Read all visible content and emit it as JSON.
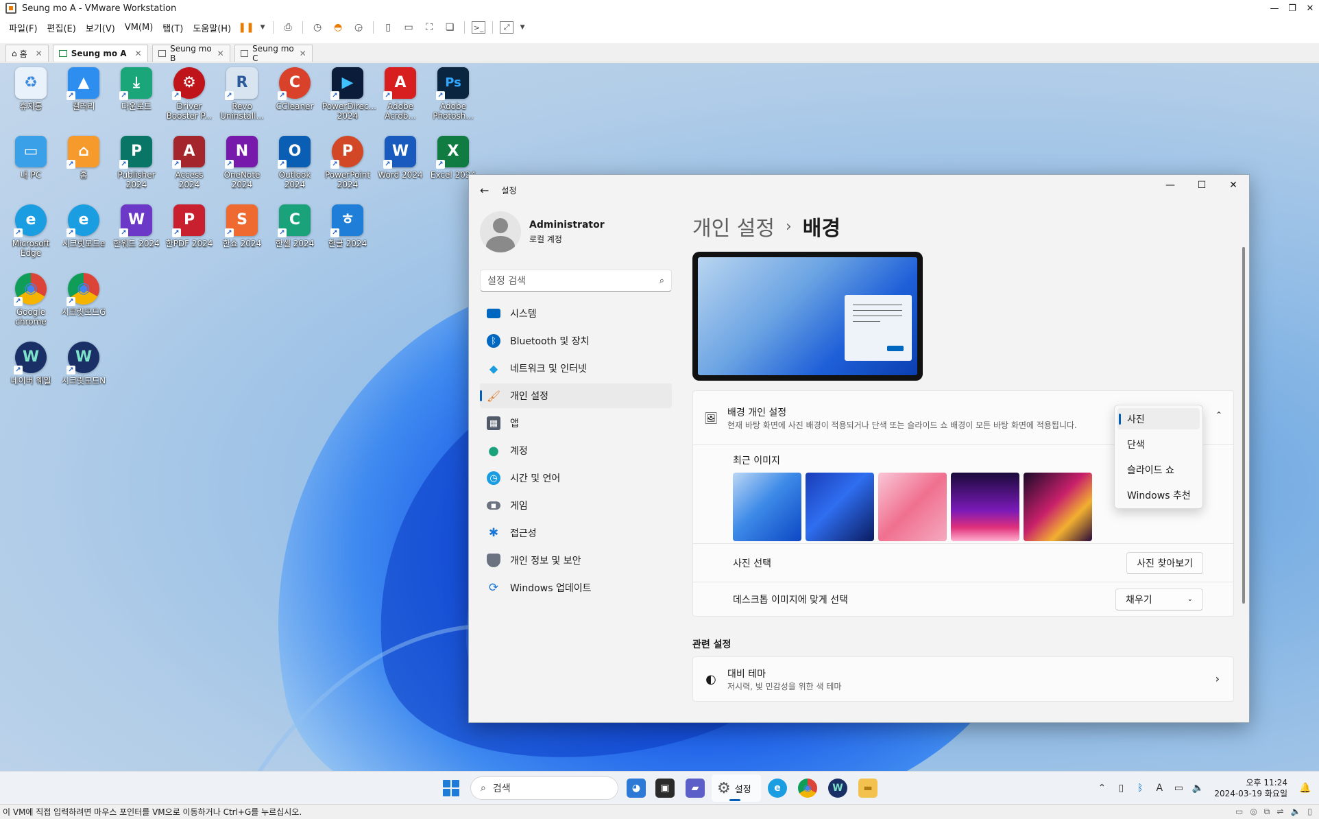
{
  "vmware": {
    "title": "Seung mo A - VMware Workstation",
    "menu": [
      "파일(F)",
      "편집(E)",
      "보기(V)",
      "VM(M)",
      "탭(T)",
      "도움말(H)"
    ],
    "tabs": [
      {
        "label": "홈"
      },
      {
        "label": "Seung mo A"
      },
      {
        "label": "Seung mo B"
      },
      {
        "label": "Seung mo C"
      }
    ],
    "status_text": "이 VM에 직접 입력하려면 마우스 포인터를 VM으로 이동하거나 Ctrl+G를 누르십시오."
  },
  "desktop": {
    "icons": [
      {
        "label": "휴지통",
        "color": "#ffffff",
        "glyph": "♻"
      },
      {
        "label": "갤러리",
        "color": "#2e8ef0",
        "glyph": "▲"
      },
      {
        "label": "다운로드",
        "color": "#1ba67a",
        "glyph": "⤓"
      },
      {
        "label": "Driver Booster P...",
        "color": "#c0141b",
        "glyph": "⚙"
      },
      {
        "label": "Revo Uninstall...",
        "color": "#d8e4f0",
        "glyph": "R"
      },
      {
        "label": "CCleaner",
        "color": "#d9412a",
        "glyph": "C"
      },
      {
        "label": "PowerDirec... 2024",
        "color": "#0b1b3a",
        "glyph": "▶"
      },
      {
        "label": "Adobe Acrob...",
        "color": "#d81f1f",
        "glyph": "A"
      },
      {
        "label": "Adobe Photosh...",
        "color": "#0a2540",
        "glyph": "Ps"
      },
      {
        "label": "내 PC",
        "color": "#3aa0e8",
        "glyph": "▭"
      },
      {
        "label": "홈",
        "color": "#f59a2b",
        "glyph": "⌂"
      },
      {
        "label": "Publisher 2024",
        "color": "#087566",
        "glyph": "P"
      },
      {
        "label": "Access 2024",
        "color": "#a4262c",
        "glyph": "A"
      },
      {
        "label": "OneNote 2024",
        "color": "#7719aa",
        "glyph": "N"
      },
      {
        "label": "Outlook 2024",
        "color": "#0a5fb4",
        "glyph": "O"
      },
      {
        "label": "PowerPoint 2024",
        "color": "#d24726",
        "glyph": "P"
      },
      {
        "label": "Word 2024",
        "color": "#185abd",
        "glyph": "W"
      },
      {
        "label": "Excel 2024",
        "color": "#107c41",
        "glyph": "X"
      },
      {
        "label": "Microsoft Edge",
        "color": "#1b9de2",
        "glyph": "e"
      },
      {
        "label": "시크릿모드e",
        "color": "#1b9de2",
        "glyph": "e"
      },
      {
        "label": "한워드 2024",
        "color": "#6b38c8",
        "glyph": "W"
      },
      {
        "label": "한PDF 2024",
        "color": "#c8202f",
        "glyph": "P"
      },
      {
        "label": "한쇼 2024",
        "color": "#ef6a30",
        "glyph": "S"
      },
      {
        "label": "한셀 2024",
        "color": "#1aa37a",
        "glyph": "C"
      },
      {
        "label": "한글 2024",
        "color": "#1f7fd8",
        "glyph": "ㅎ"
      },
      {
        "label": "Google chrome",
        "color": "#ffffff",
        "glyph": "◉"
      },
      {
        "label": "시크릿모드G",
        "color": "#ffffff",
        "glyph": "◉"
      },
      {
        "label": "네이버 웨일",
        "color": "#1a2f66",
        "glyph": "W"
      },
      {
        "label": "시크릿모드N",
        "color": "#1a2f66",
        "glyph": "W"
      }
    ]
  },
  "settings": {
    "app_title": "설정",
    "profile": {
      "name": "Administrator",
      "sub": "로컬 계정"
    },
    "search_placeholder": "설정 검색",
    "nav": [
      {
        "label": "시스템",
        "icon": "monitor-icon",
        "color": "#0067c0"
      },
      {
        "label": "Bluetooth 및 장치",
        "icon": "bluetooth-icon",
        "color": "#0067c0"
      },
      {
        "label": "네트워크 및 인터넷",
        "icon": "wifi-icon",
        "color": "#1b9de2"
      },
      {
        "label": "개인 설정",
        "icon": "brush-icon",
        "color": "#e07b2a"
      },
      {
        "label": "앱",
        "icon": "apps-icon",
        "color": "#505a68"
      },
      {
        "label": "계정",
        "icon": "person-icon",
        "color": "#1aa37a"
      },
      {
        "label": "시간 및 언어",
        "icon": "clock-icon",
        "color": "#1b9de2"
      },
      {
        "label": "게임",
        "icon": "gamepad-icon",
        "color": "#6b7280"
      },
      {
        "label": "접근성",
        "icon": "accessibility-icon",
        "color": "#1b78d8"
      },
      {
        "label": "개인 정보 및 보안",
        "icon": "shield-icon",
        "color": "#6b7280"
      },
      {
        "label": "Windows 업데이트",
        "icon": "update-icon",
        "color": "#1b78d8"
      }
    ],
    "breadcrumb": {
      "parent": "개인 설정",
      "sep": "›",
      "current": "배경"
    },
    "bg_card": {
      "title": "배경 개인 설정",
      "desc": "현재 바탕 화면에 사진 배경이 적용되거나 단색 또는 슬라이드 쇼 배경이 모든 바탕 화면에 적용됩니다.",
      "dropdown": [
        "사진",
        "단색",
        "슬라이드 쇼",
        "Windows 추천"
      ],
      "recent_label": "최근 이미지",
      "recent_colors": [
        "linear-gradient(135deg,#bcd7f5,#3d8ae8 45%,#0c47c4)",
        "linear-gradient(135deg,#1a3db8,#2f6ef0 45%,#0a1b60)",
        "linear-gradient(135deg,#f9c6d6,#f0708f 50%,#f5a9c0)",
        "linear-gradient(180deg,#1a0a3a,#7a1ab8 55%,#e0307a 80%,#ffb0d0)",
        "linear-gradient(135deg,#1a0a2a,#c8206a 45%,#f2b030 70%,#2a0a3a)"
      ],
      "choose_label": "사진 선택",
      "choose_button": "사진 찾아보기",
      "fit_label": "데스크톱 이미지에 맞게 선택",
      "fit_value": "채우기"
    },
    "related": {
      "title": "관련 설정",
      "contrast_title": "대비 테마",
      "contrast_desc": "저시력, 빛 민감성을 위한 색 테마"
    }
  },
  "taskbar": {
    "search_placeholder": "검색",
    "settings_label": "설정",
    "time": "오후 11:24",
    "date": "2024-03-19 화요일"
  }
}
